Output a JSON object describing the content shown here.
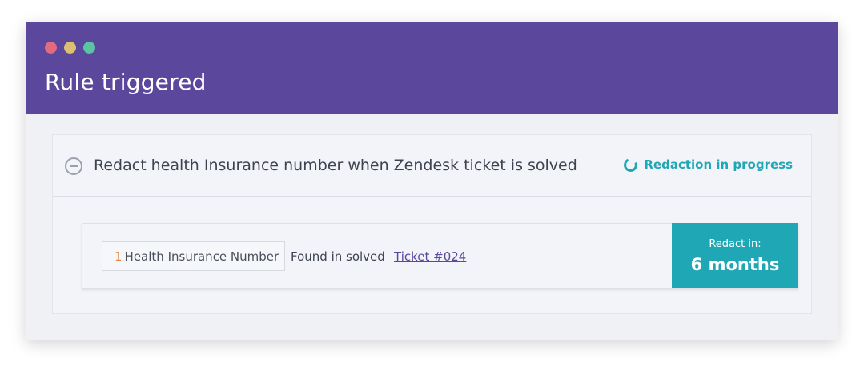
{
  "window": {
    "title": "Rule triggered",
    "dots": [
      {
        "name": "close",
        "color": "#e46a7d"
      },
      {
        "name": "minimize",
        "color": "#d9c073"
      },
      {
        "name": "maximize",
        "color": "#5ac4a4"
      }
    ]
  },
  "rule": {
    "title": "Redact health Insurance number when Zendesk ticket is solved",
    "collapse_icon": "minus-circle-icon",
    "status": {
      "icon": "spinner-icon",
      "label": "Redaction in progress",
      "color": "#20a7b5"
    }
  },
  "finding": {
    "count": "1",
    "type": "Health Insurance Number",
    "found_text": "Found in solved",
    "ticket_link": "Ticket #024",
    "redact_label": "Redact in:",
    "redact_value": "6 months"
  },
  "colors": {
    "header": "#5b479c",
    "accent": "#20a7b5",
    "count": "#e58a4a"
  }
}
